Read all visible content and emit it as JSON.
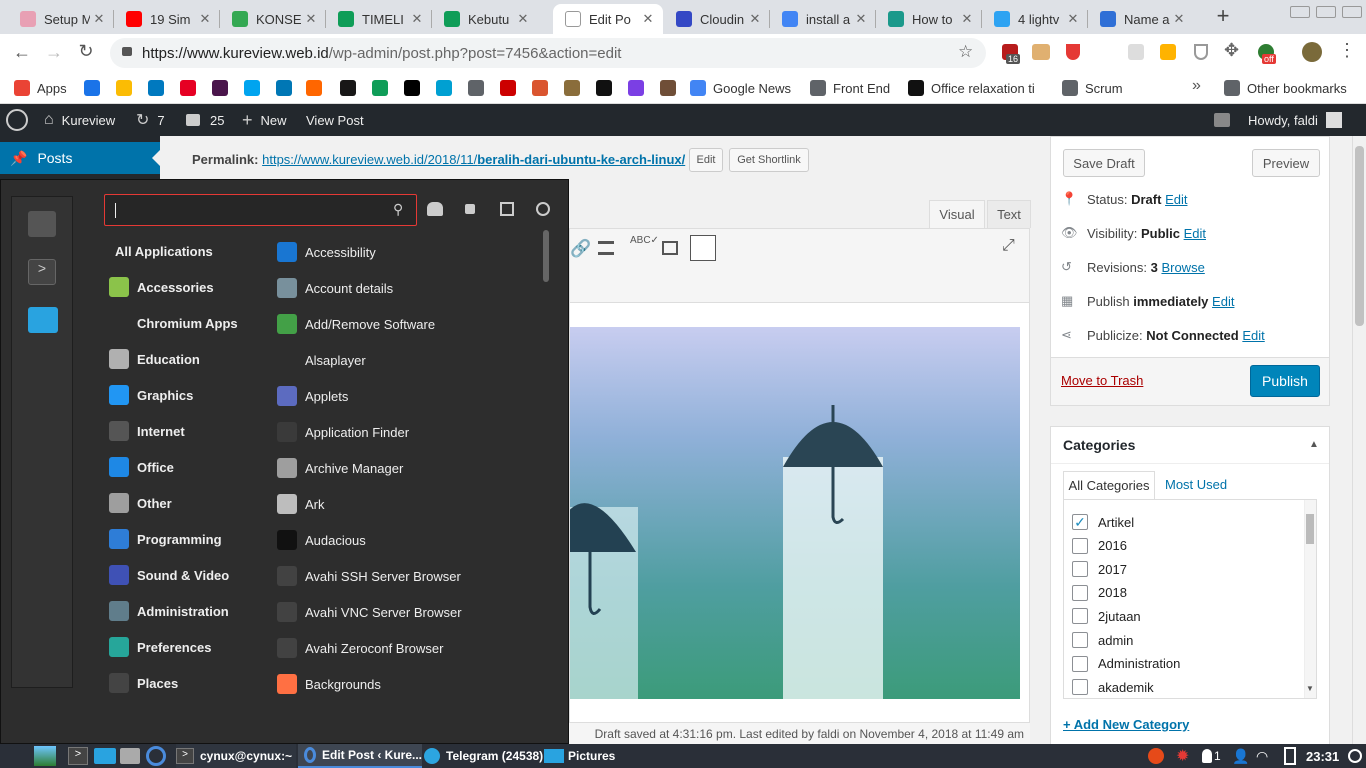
{
  "browser": {
    "tabs": [
      {
        "title": "Setup M",
        "color": "#e8a0b4"
      },
      {
        "title": "19 Sim",
        "color": "#ff0000"
      },
      {
        "title": "KONSE",
        "color": "#34a853"
      },
      {
        "title": "TIMELI",
        "color": "#0f9d58"
      },
      {
        "title": "Kebutu",
        "color": "#0f9d58"
      },
      {
        "title": "Edit Po",
        "color": "#ffffff"
      },
      {
        "title": "Cloudin",
        "color": "#3448c5"
      },
      {
        "title": "install a",
        "color": "#4285f4"
      },
      {
        "title": "How to",
        "color": "#1b998b"
      },
      {
        "title": "4 lightv",
        "color": "#2ea3f2"
      },
      {
        "title": "Name a",
        "color": "#2f6fd6"
      }
    ],
    "new_tab": "+",
    "url_host": "https://www.kureview.web.id",
    "url_path": "/wp-admin/post.php?post=7456&action=edit",
    "ext_badge_16": "16",
    "ext_badge_off": "off",
    "bookmarks": [
      {
        "label": "Apps",
        "color": "#ea4335"
      },
      {
        "label": "",
        "color": "#1a73e8"
      },
      {
        "label": "",
        "color": "#fbbc04"
      },
      {
        "label": "",
        "color": "#0079bf"
      },
      {
        "label": "",
        "color": "#e60023"
      },
      {
        "label": "",
        "color": "#4a154b"
      },
      {
        "label": "",
        "color": "#00a4ef"
      },
      {
        "label": "",
        "color": "#0077b5"
      },
      {
        "label": "",
        "color": "#ff6600"
      },
      {
        "label": "",
        "color": "#181717"
      },
      {
        "label": "",
        "color": "#0f9d58"
      },
      {
        "label": "",
        "color": "#000000"
      },
      {
        "label": "",
        "color": "#00a0d2"
      },
      {
        "label": "",
        "color": "#5f6368"
      },
      {
        "label": "",
        "color": "#cc0000"
      },
      {
        "label": "",
        "color": "#da552f"
      },
      {
        "label": "",
        "color": "#8a6d3b"
      },
      {
        "label": "",
        "color": "#111111"
      },
      {
        "label": "",
        "color": "#7b3fe4"
      },
      {
        "label": "",
        "color": "#6f4e37"
      },
      {
        "label": "Google News",
        "color": "#4285f4"
      },
      {
        "label": "Front End",
        "color": "#5f6368"
      },
      {
        "label": "Office relaxation ti",
        "color": "#111111"
      },
      {
        "label": "Scrum",
        "color": "#5f6368"
      }
    ],
    "more_bookmarks": "»",
    "other_bookmarks": "Other bookmarks"
  },
  "wp": {
    "site": "Kureview",
    "updates": "7",
    "comments": "25",
    "new": "New",
    "view_post": "View Post",
    "howdy": "Howdy, faldi",
    "sidebar_posts": "Posts",
    "permalink_label": "Permalink:",
    "permalink_base": "https://www.kureview.web.id/2018/11/",
    "permalink_slug": "beralih-dari-ubuntu-ke-arch-linux/",
    "edit_btn": "Edit",
    "shortlink_btn": "Get Shortlink",
    "tab_visual": "Visual",
    "tab_text": "Text",
    "status_bar": "Draft saved at 4:31:16 pm. Last edited by faldi on November 4, 2018 at 11:49 am",
    "publish": {
      "save_draft": "Save Draft",
      "preview": "Preview",
      "status_label": "Status:",
      "status_value": "Draft",
      "visibility_label": "Visibility:",
      "visibility_value": "Public",
      "revisions_label": "Revisions:",
      "revisions_value": "3",
      "browse": "Browse",
      "publish_label": "Publish",
      "publish_value": "immediately",
      "publicize_label": "Publicize:",
      "publicize_value": "Not Connected",
      "edit": "Edit",
      "trash": "Move to Trash",
      "publish_btn": "Publish"
    },
    "categories": {
      "title": "Categories",
      "tab_all": "All Categories",
      "tab_used": "Most Used",
      "items": [
        {
          "label": "Artikel",
          "checked": true
        },
        {
          "label": "2016",
          "checked": false
        },
        {
          "label": "2017",
          "checked": false
        },
        {
          "label": "2018",
          "checked": false
        },
        {
          "label": "2jutaan",
          "checked": false
        },
        {
          "label": "admin",
          "checked": false
        },
        {
          "label": "Administration",
          "checked": false
        },
        {
          "label": "akademik",
          "checked": false
        }
      ],
      "add_new": "+ Add New Category"
    }
  },
  "menu": {
    "search_value": "",
    "categories": [
      {
        "label": "All Applications",
        "color": ""
      },
      {
        "label": "Accessories",
        "color": "#8bc34a"
      },
      {
        "label": "Chromium Apps",
        "color": ""
      },
      {
        "label": "Education",
        "color": "#b0b0b0"
      },
      {
        "label": "Graphics",
        "color": "#2196f3"
      },
      {
        "label": "Internet",
        "color": "#555555"
      },
      {
        "label": "Office",
        "color": "#1e88e5"
      },
      {
        "label": "Other",
        "color": "#9e9e9e"
      },
      {
        "label": "Programming",
        "color": "#2e7dd7"
      },
      {
        "label": "Sound & Video",
        "color": "#3f51b5"
      },
      {
        "label": "Administration",
        "color": "#607d8b"
      },
      {
        "label": "Preferences",
        "color": "#26a69a"
      },
      {
        "label": "Places",
        "color": "#444444"
      }
    ],
    "apps": [
      {
        "label": "Accessibility",
        "color": "#1976d2"
      },
      {
        "label": "Account details",
        "color": "#78909c"
      },
      {
        "label": "Add/Remove Software",
        "color": "#43a047"
      },
      {
        "label": "Alsaplayer",
        "color": ""
      },
      {
        "label": "Applets",
        "color": "#5c6bc0"
      },
      {
        "label": "Application Finder",
        "color": "#3a3a3a"
      },
      {
        "label": "Archive Manager",
        "color": "#9e9e9e"
      },
      {
        "label": "Ark",
        "color": "#bdbdbd"
      },
      {
        "label": "Audacious",
        "color": "#111111"
      },
      {
        "label": "Avahi SSH Server Browser",
        "color": "#424242"
      },
      {
        "label": "Avahi VNC Server Browser",
        "color": "#424242"
      },
      {
        "label": "Avahi Zeroconf Browser",
        "color": "#424242"
      },
      {
        "label": "Backgrounds",
        "color": "#ff7043"
      }
    ]
  },
  "taskbar": {
    "terminal": "cynux@cynux:~",
    "chrome": "Edit Post ‹ Kure...",
    "telegram": "Telegram (24538)",
    "pictures": "Pictures",
    "notify_count": "1",
    "clock": "23:31"
  }
}
